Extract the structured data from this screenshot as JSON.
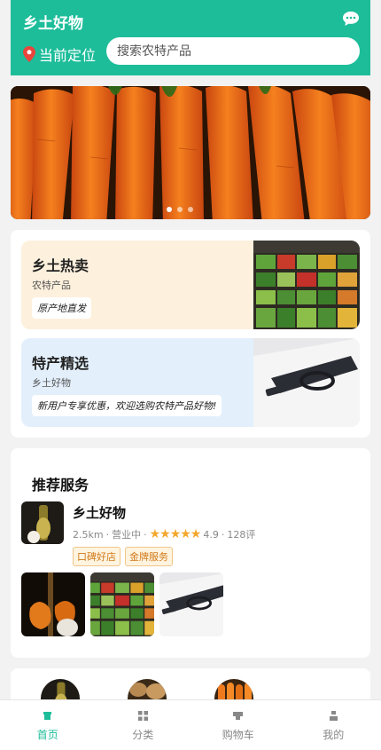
{
  "header": {
    "title": "乡土好物",
    "message_icon": "chat-bubble-icon",
    "location_icon": "map-pin-icon",
    "location_label": "当前定位",
    "search_placeholder": "搜索农特产品"
  },
  "banner": {
    "slides": 3,
    "active_slide": 1
  },
  "promos": [
    {
      "title": "乡土热卖",
      "subtitle": "农特产品",
      "tag": "原产地直发",
      "bg": "#fdf0dd"
    },
    {
      "title": "特产精选",
      "subtitle": "乡土好物",
      "tag": "新用户专享优惠，欢迎选购农特产品好物!",
      "bg": "#e3f0fc"
    }
  ],
  "recommend": {
    "title": "推荐服务",
    "shop": {
      "name": "乡土好物",
      "distance": "2.5km",
      "status": "营业中",
      "stars": "★★★★★",
      "rating": "4.9",
      "reviews": "128评",
      "badges": [
        "口碑好店",
        "金牌服务"
      ]
    }
  },
  "tabbar": [
    {
      "label": "首页",
      "icon": "home-icon",
      "active": true
    },
    {
      "label": "分类",
      "icon": "grid-icon",
      "active": false
    },
    {
      "label": "购物车",
      "icon": "cart-icon",
      "active": false
    },
    {
      "label": "我的",
      "icon": "user-icon",
      "active": false
    }
  ],
  "colors": {
    "brand": "#1dbd9a",
    "star": "#f3a72c",
    "badge_text": "#d07a1a"
  }
}
